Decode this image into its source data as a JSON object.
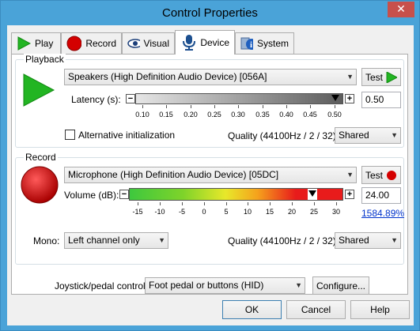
{
  "window": {
    "title": "Control Properties",
    "close_glyph": "✕"
  },
  "tabs": [
    {
      "label": "Play",
      "icon": "play-icon"
    },
    {
      "label": "Record",
      "icon": "record-icon"
    },
    {
      "label": "Visual",
      "icon": "eye-icon"
    },
    {
      "label": "Device",
      "icon": "microphone-icon",
      "active": true
    },
    {
      "label": "System",
      "icon": "info-icon"
    }
  ],
  "playback": {
    "group_label": "Playback",
    "device": "Speakers (High Definition Audio Device) [056A]",
    "test_label": "Test",
    "latency_label": "Latency (s):",
    "latency_value": "0.50",
    "latency_ticks": [
      "0.10",
      "0.15",
      "0.20",
      "0.25",
      "0.30",
      "0.35",
      "0.40",
      "0.45",
      "0.50"
    ],
    "latency_level": 1.0,
    "alt_init_label": "Alternative initialization",
    "alt_init_checked": false,
    "quality_label": "Quality (44100Hz / 2 / 32):",
    "quality_value": "Shared"
  },
  "record": {
    "group_label": "Record",
    "device": "Microphone (High Definition Audio Device) [05DC]",
    "test_label": "Test",
    "volume_label": "Volume (dB):",
    "volume_value": "24.00",
    "volume_percent": "1584.89%",
    "volume_ticks": [
      "-15",
      "-10",
      "-5",
      "0",
      "5",
      "10",
      "15",
      "20",
      "25",
      "30"
    ],
    "mono_label": "Mono:",
    "mono_value": "Left channel only",
    "quality_label": "Quality (44100Hz / 2 / 32):",
    "quality_value": "Shared"
  },
  "joystick": {
    "label": "Joystick/pedal control:",
    "value": "Foot pedal or buttons (HID)",
    "configure_label": "Configure..."
  },
  "footer": {
    "ok": "OK",
    "cancel": "Cancel",
    "help": "Help"
  },
  "colors": {
    "play_green": "#22b522",
    "record_red": "#cc0000",
    "accent": "#4aa3d8"
  }
}
